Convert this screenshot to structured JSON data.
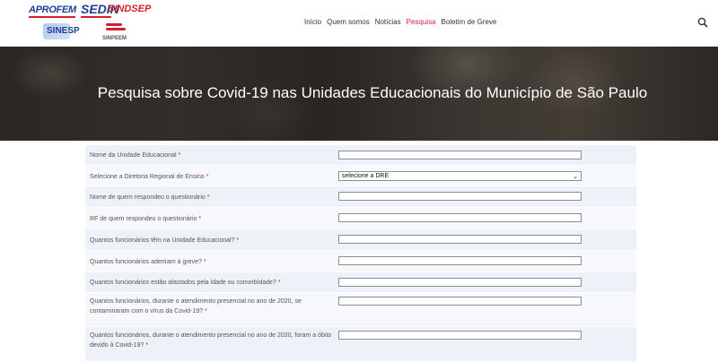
{
  "logos": {
    "aprofem": "APROFEM",
    "sedin": "SEDIN",
    "sindsep": "SINDSEP",
    "sinesp": "SINESP",
    "sinpeem": "SINPEEM"
  },
  "nav": {
    "items": [
      {
        "label": "Início",
        "active": false
      },
      {
        "label": "Quem somos",
        "active": false
      },
      {
        "label": "Notícias",
        "active": false
      },
      {
        "label": "Pesquisa",
        "active": true
      },
      {
        "label": "Boletim de Greve",
        "active": false
      }
    ],
    "search_icon": "search-icon",
    "active_color": "#d5195b"
  },
  "hero": {
    "title": "Pesquisa sobre Covid-19 nas Unidades Educacionais do Município de São Paulo"
  },
  "form": {
    "required_mark": "*",
    "fields": [
      {
        "label": "Nome da Unidade Educacional",
        "type": "text",
        "value": ""
      },
      {
        "label": "Selecione a Diretoria Regional de Ensino",
        "type": "select",
        "value": "selecione a DRE"
      },
      {
        "label": "Nome de quem respondeu o questionário",
        "type": "text",
        "value": ""
      },
      {
        "label": "RF de quem respondeu o questionário",
        "type": "text",
        "value": ""
      },
      {
        "label": "Quantos funcionários têm na Unidade Educacional?",
        "type": "text",
        "value": ""
      },
      {
        "label": "Quantos funcionários aderiram à greve?",
        "type": "text",
        "value": ""
      },
      {
        "label": "Quantos funcionários estão afastados pela idade ou comorbidade?",
        "type": "text",
        "value": ""
      },
      {
        "label": "Quantos funcionários, durante o atendimento presencial no ano de 2020, se contaminaram com o vírus da Covid-19?",
        "type": "text",
        "value": ""
      },
      {
        "label": "Quantos funcionários, durante o atendimento presencial no ano de 2020, foram a óbito devido à Covid-19?",
        "type": "text",
        "value": ""
      }
    ]
  }
}
